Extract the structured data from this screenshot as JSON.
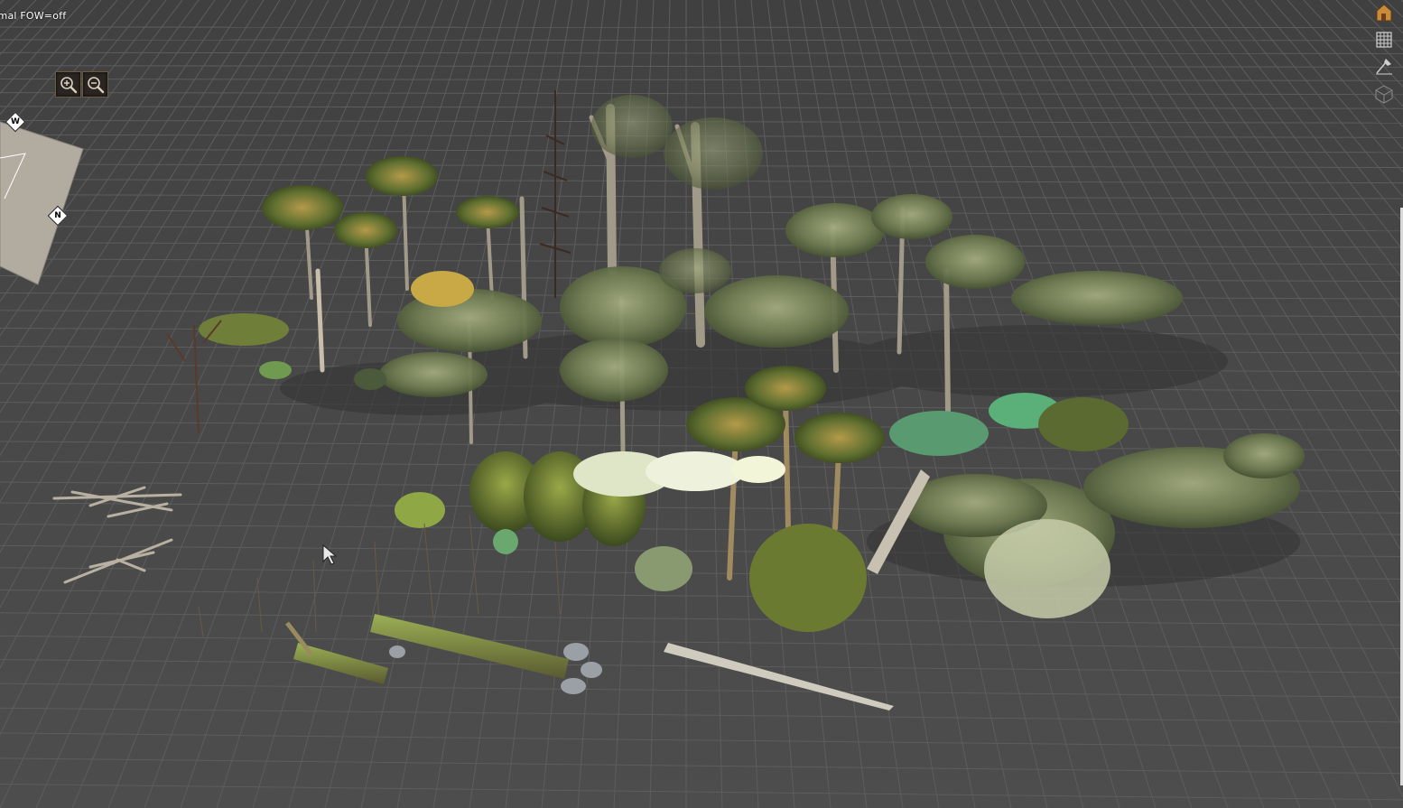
{
  "status_line": "rmal  FOW=off",
  "zoom": {
    "zoom_in_icon": "zoom-in-icon",
    "zoom_out_icon": "zoom-out-icon"
  },
  "minimap": {
    "compass_west": "W",
    "compass_north": "N"
  },
  "toolbar": {
    "tools": [
      "house-icon",
      "grid-icon",
      "paint-brush-icon",
      "wireframe-cube-icon"
    ]
  },
  "colors": {
    "background": "#454545",
    "grid_line": "#5e5e5e",
    "foliage_dark": "#3f4a30",
    "foliage_light": "#8e9a70",
    "trunk": "#9a9080",
    "accent_orange": "#c98a3a"
  }
}
